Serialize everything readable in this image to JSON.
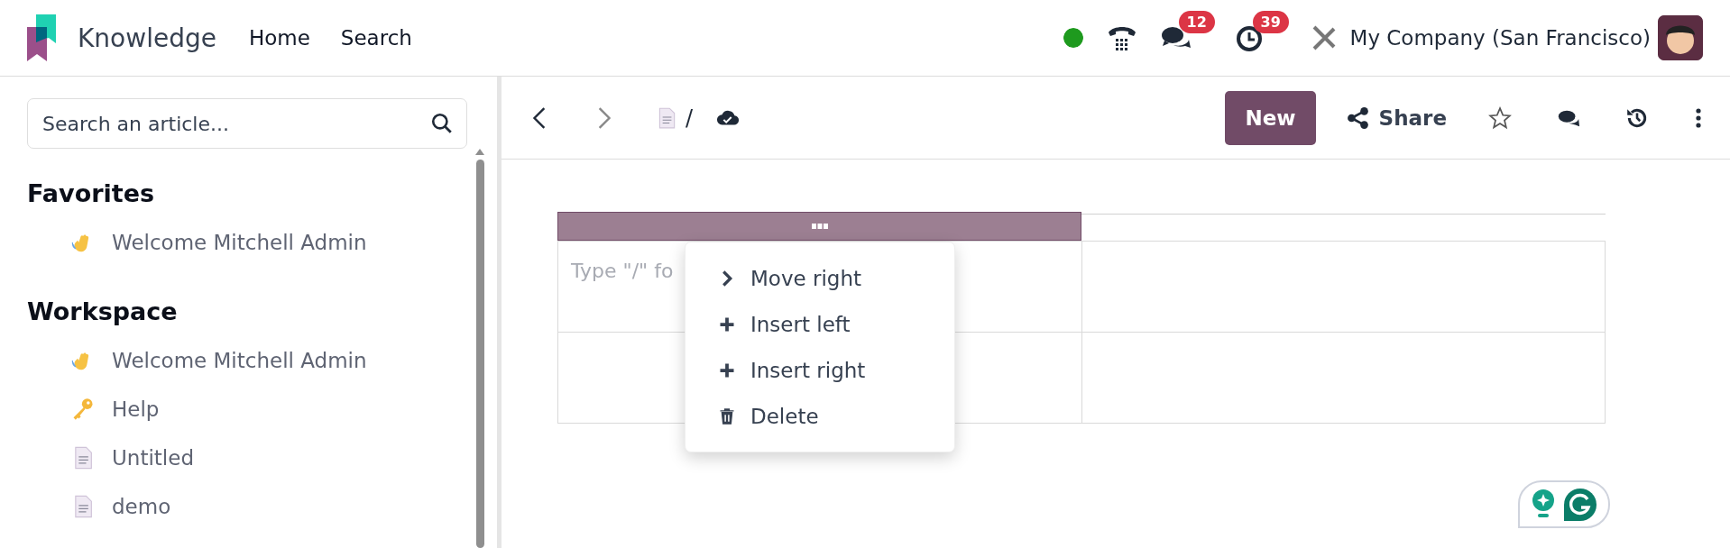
{
  "app": {
    "name": "Knowledge"
  },
  "nav": [
    {
      "label": "Home"
    },
    {
      "label": "Search"
    }
  ],
  "systray": {
    "messages_badge": "12",
    "activities_badge": "39",
    "company": "My Company (San Francisco)"
  },
  "sidebar": {
    "search": {
      "placeholder": "Search an article..."
    },
    "sections": [
      {
        "title": "Favorites",
        "items": [
          {
            "label": "Welcome Mitchell Admin",
            "kind": "wave"
          }
        ]
      },
      {
        "title": "Workspace",
        "items": [
          {
            "label": "Welcome Mitchell Admin",
            "kind": "wave"
          },
          {
            "label": "Help",
            "kind": "key"
          },
          {
            "label": "Untitled",
            "kind": "doc"
          },
          {
            "label": "demo",
            "kind": "doc"
          }
        ]
      }
    ]
  },
  "toolbar": {
    "breadcrumb_separator": "/",
    "new_button": "New",
    "share_button": "Share"
  },
  "table": {
    "rows": [
      [
        "",
        ""
      ],
      [
        "",
        ""
      ]
    ],
    "placeholder": "Type \"/\" fo"
  },
  "column_menu": [
    {
      "label": "Move right",
      "kind": "chevron"
    },
    {
      "label": "Insert left",
      "kind": "plus"
    },
    {
      "label": "Insert right",
      "kind": "plus"
    },
    {
      "label": "Delete",
      "kind": "trash"
    }
  ]
}
